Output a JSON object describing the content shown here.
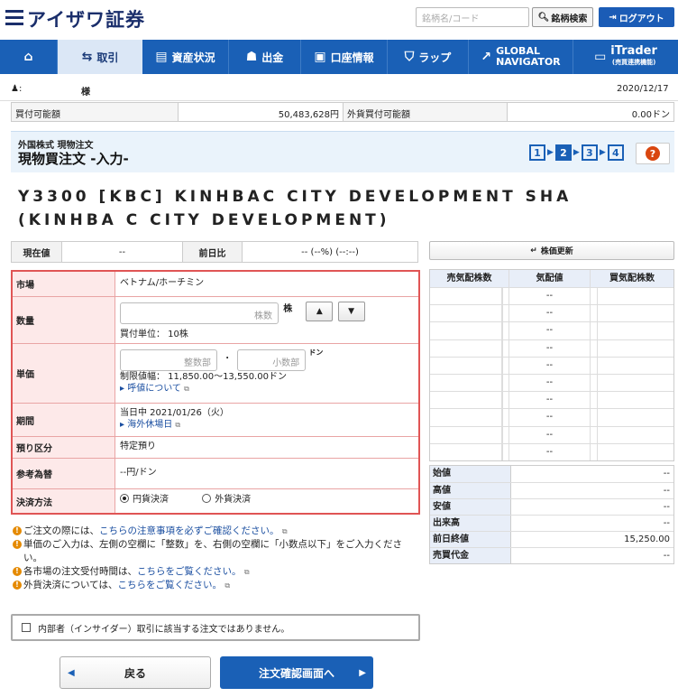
{
  "header": {
    "brand": "アイザワ証券",
    "search_placeholder": "銘柄名/コード",
    "search_button": "銘柄検索",
    "logout_button": "ログアウト"
  },
  "nav": {
    "home": "",
    "trade": "取引",
    "assets": "資産状況",
    "withdraw": "出金",
    "account": "口座情報",
    "wrap": "ラップ",
    "global_line1": "GLOBAL",
    "global_line2": "NAVIGATOR",
    "itrader": "iTrader",
    "itrader_sub": "(売買連携機能)"
  },
  "user": {
    "name_suffix": "様",
    "date": "2020/12/17"
  },
  "balance": {
    "buy_label": "買付可能額",
    "buy_value": "50,483,628円",
    "fx_label": "外貨買付可能額",
    "fx_value": "0.00ドン"
  },
  "title": {
    "sub": "外国株式 現物注文",
    "main": "現物買注文 -入力-",
    "steps": [
      "1",
      "2",
      "3",
      "4"
    ],
    "active_step": "2",
    "help": "?"
  },
  "stock": {
    "name": "Y3300 [KBC] KINHBAC CITY DEVELOPMENT SHA (KINHBA C CITY DEVELOPMENT)"
  },
  "price": {
    "current_label": "現在値",
    "current_value": "--",
    "change_label": "前日比",
    "change_value": "-- (--%) (--:--)",
    "refresh_button": "株価更新"
  },
  "form": {
    "market_label": "市場",
    "market_value": "ベトナム/ホーチミン",
    "qty_label": "数量",
    "qty_placeholder": "株数",
    "qty_unit": "株",
    "qty_note": "買付単位： 10株",
    "price_label": "単価",
    "int_placeholder": "整数部",
    "dec_placeholder": "小数部",
    "price_unit": "ドン",
    "limit_note": "制限値幅： 11,850.00〜13,550.00ドン",
    "tick_link": "呼値について",
    "period_label": "期間",
    "period_value": "当日中 2021/01/26（火）",
    "holiday_link": "海外休場日",
    "custody_label": "預り区分",
    "custody_value": "特定預り",
    "fx_rate_label": "参考為替",
    "fx_rate_value": "--円/ドン",
    "settle_label": "決済方法",
    "settle_yen": "円貨決済",
    "settle_fx": "外貨決済"
  },
  "board": {
    "ask_header": "売気配株数",
    "price_header": "気配値",
    "bid_header": "買気配株数",
    "prices": [
      "--",
      "--",
      "--",
      "--",
      "--",
      "--",
      "--",
      "--",
      "--",
      "--"
    ]
  },
  "ohlc": [
    {
      "label": "始値",
      "value": "--"
    },
    {
      "label": "高値",
      "value": "--"
    },
    {
      "label": "安値",
      "value": "--"
    },
    {
      "label": "出来高",
      "value": "--"
    },
    {
      "label": "前日終値",
      "value": "15,250.00"
    },
    {
      "label": "売買代金",
      "value": "--"
    }
  ],
  "notes": {
    "n1_prefix": "ご注文の際には、",
    "n1_link": "こちらの注意事項を必ずご確認ください。",
    "n2": "単価のご入力は、左側の空欄に「整数」を、右側の空欄に「小数点以下」をご入力ください。",
    "n3_prefix": "各市場の注文受付時間は、",
    "n3_link": "こちらをご覧ください。",
    "n4_prefix": "外貨決済については、",
    "n4_link": "こちらをご覧ください。"
  },
  "insider": "内部者（インサイダー）取引に該当する注文ではありません。",
  "buttons": {
    "back": "戻る",
    "next": "注文確認画面へ"
  }
}
